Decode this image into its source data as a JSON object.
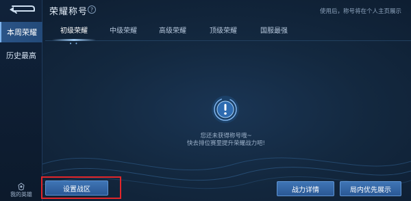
{
  "colors": {
    "accent": "#7fb4ee",
    "button": "#3567a5",
    "highlight": "#e3262a",
    "background": "#13283f"
  },
  "header": {
    "title": "荣耀称号",
    "help_icon": "question-icon",
    "hint": "使用后，称号将在个人主页展示"
  },
  "sidebar": {
    "back_icon": "back-arrow-icon",
    "items": [
      {
        "label": "本周荣耀",
        "active": true
      },
      {
        "label": "历史最高",
        "active": false
      }
    ],
    "hero": {
      "label": "我的英雄",
      "icon": "hero-icon"
    }
  },
  "tabs": [
    {
      "label": "初级荣耀",
      "active": true
    },
    {
      "label": "中级荣耀",
      "active": false
    },
    {
      "label": "高级荣耀",
      "active": false
    },
    {
      "label": "顶级荣耀",
      "active": false
    },
    {
      "label": "国服最强",
      "active": false
    }
  ],
  "content": {
    "emblem_icon": "exclamation-badge-icon",
    "empty_line1": "您还未获得称号哦~",
    "empty_line2": "快去排位赛里提升荣耀战力吧!"
  },
  "buttons": {
    "set_region": "设置战区",
    "power_details": "战力详情",
    "in_game_display": "局内优先展示"
  }
}
